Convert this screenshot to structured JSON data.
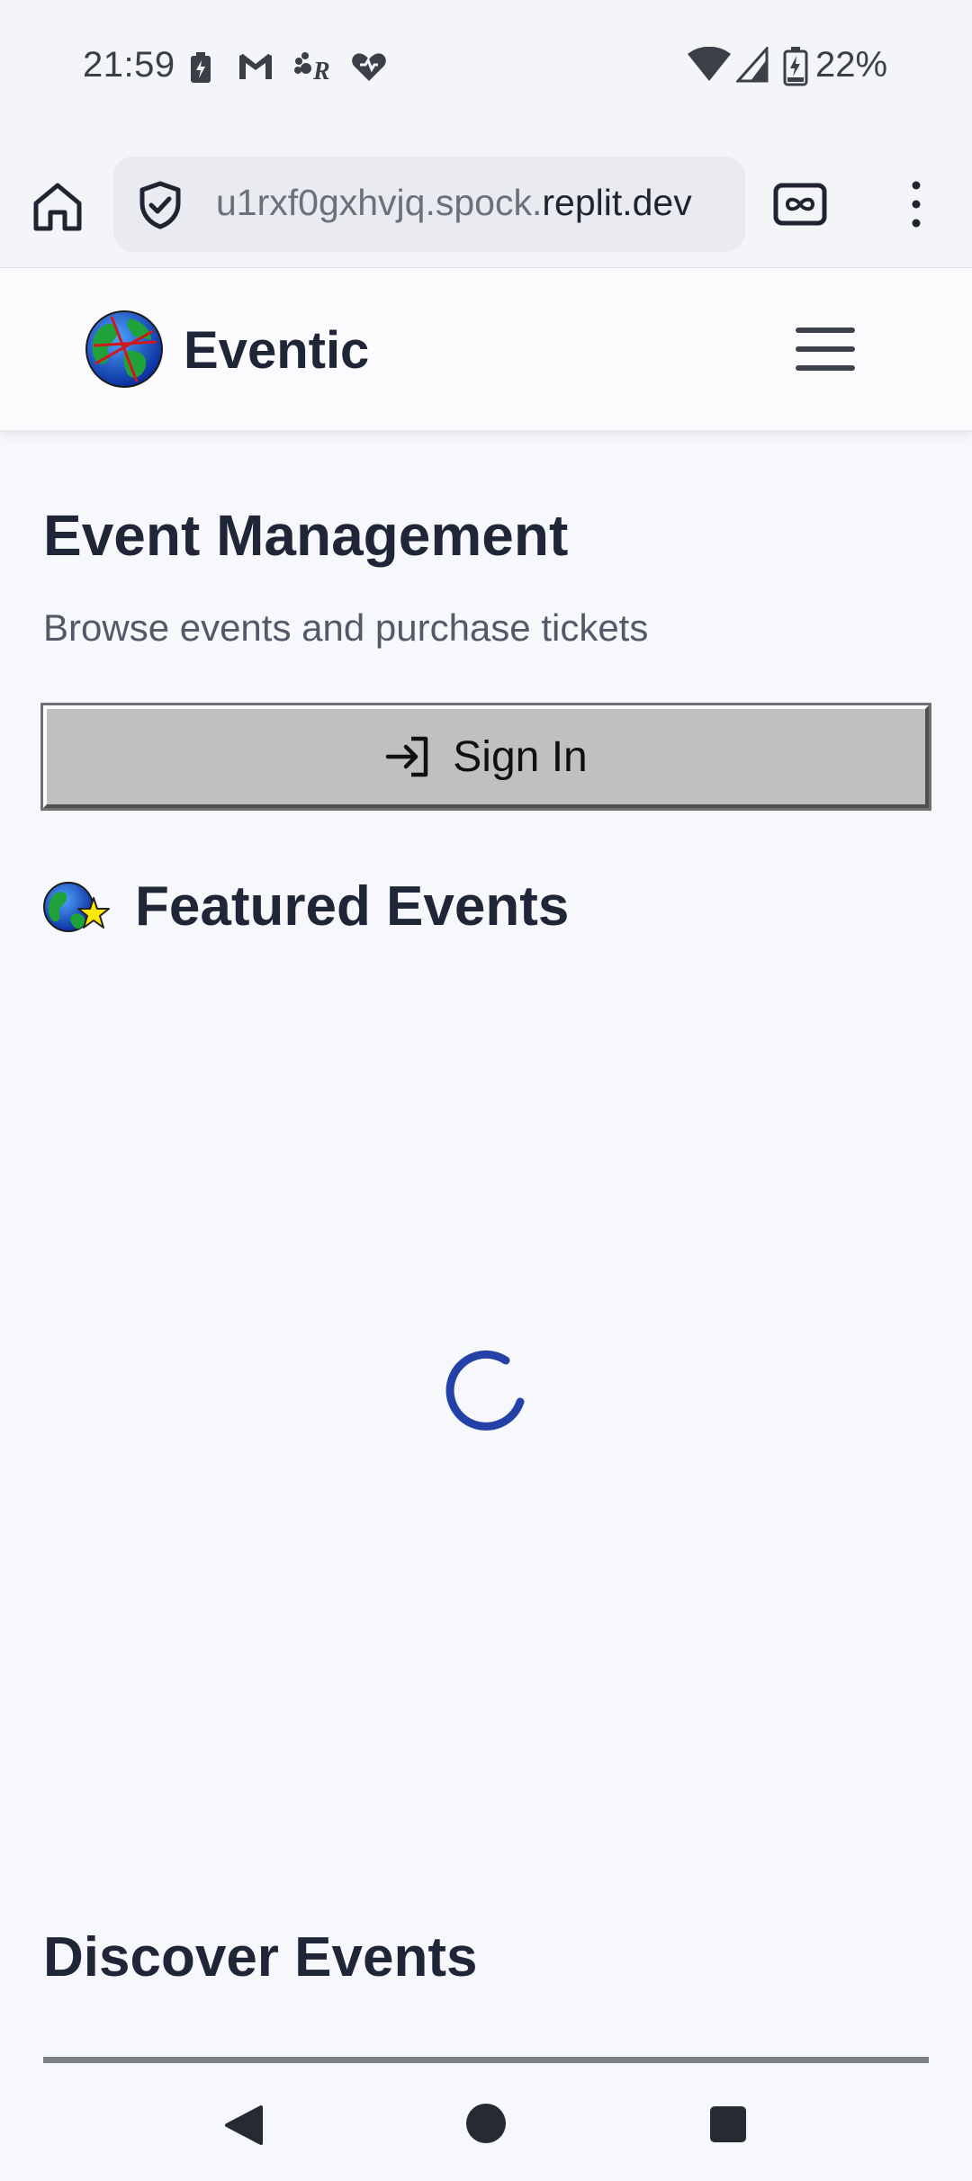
{
  "status_bar": {
    "time": "21:59",
    "battery": "22%",
    "notification_icons": [
      "battery-saver-icon",
      "gmail-icon",
      "paw-icon",
      "heart-icon"
    ],
    "system_icons": [
      "wifi-icon",
      "signal-icon",
      "battery-charging-icon"
    ]
  },
  "browser": {
    "url_prefix": "u1rxf0gxhvjq.spock.",
    "url_host": "replit.dev",
    "icons": [
      "home-icon",
      "shield-check-icon",
      "reader-mode-icon",
      "overflow-menu-icon"
    ]
  },
  "header": {
    "brand": "Eventic",
    "logo_icon": "globe-logo-icon",
    "menu_icon": "hamburger-menu-icon"
  },
  "main": {
    "title": "Event Management",
    "subtitle": "Browse events and purchase tickets",
    "signin_label": "Sign In",
    "signin_icon": "sign-in-arrow-icon",
    "featured_title": "Featured Events",
    "featured_icon": "globe-star-icon",
    "discover_title": "Discover Events"
  },
  "colors": {
    "spinner": "#2441a8",
    "button_face": "#c0c0c0",
    "heading": "#1f2637",
    "background": "#f7f8fb"
  },
  "nav": {
    "icons": [
      "back-icon",
      "home-circle-icon",
      "recents-icon"
    ]
  }
}
